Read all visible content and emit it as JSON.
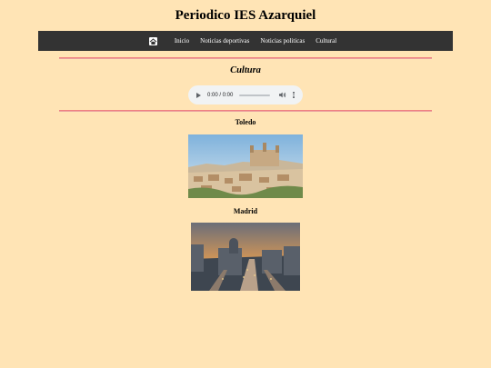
{
  "site": {
    "title": "Periodico IES Azarquiel"
  },
  "nav": {
    "home_icon": "home-icon",
    "items": [
      "Inicio",
      "Noticias deportivas",
      "Noticias politicas",
      "Cultural"
    ]
  },
  "section": {
    "title": "Cultura"
  },
  "audio": {
    "time": "0:00 / 0:00",
    "progress": 0
  },
  "articles": [
    {
      "title": "Toledo",
      "image": "toledo-cityscape-photo"
    },
    {
      "title": "Madrid",
      "image": "madrid-cityscape-photo"
    }
  ],
  "colors": {
    "background": "#ffe4b5",
    "navbar": "#333333",
    "divider": "#f08080"
  }
}
